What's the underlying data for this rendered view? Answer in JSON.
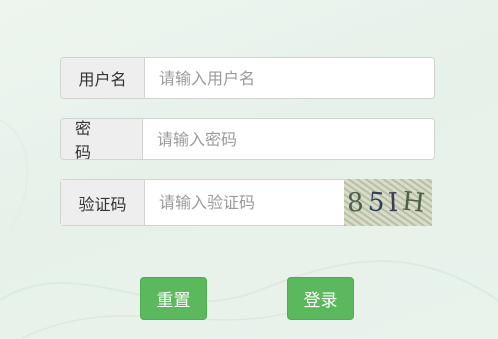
{
  "form": {
    "username": {
      "label": "用户名",
      "placeholder": "请输入用户名",
      "value": ""
    },
    "password": {
      "label": "密 码",
      "placeholder": "请输入密码",
      "value": ""
    },
    "captcha": {
      "label": "验证码",
      "placeholder": "请输入验证码",
      "value": "",
      "image_text": [
        "8",
        "5",
        "I",
        "H"
      ]
    }
  },
  "buttons": {
    "reset_label": "重置",
    "login_label": "登录"
  },
  "colors": {
    "primary_button": "#5cb85c",
    "addon_bg": "#eeeeee"
  }
}
